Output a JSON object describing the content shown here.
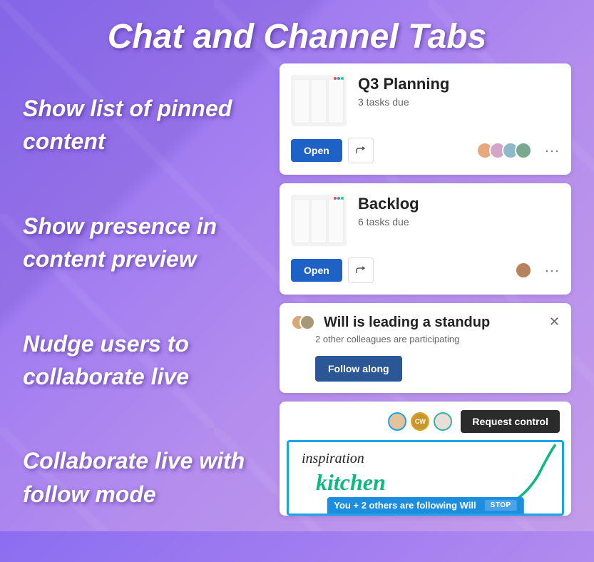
{
  "title": "Chat and Channel Tabs",
  "features": [
    "Show list of pinned content",
    "Show presence in content preview",
    "Nudge users to collaborate live",
    "Collaborate live with follow mode"
  ],
  "cards": [
    {
      "title": "Q3 Planning",
      "subtitle": "3 tasks due",
      "open_label": "Open",
      "avatars": [
        {
          "bg": "#e8a87c"
        },
        {
          "bg": "#d4a5c9"
        },
        {
          "bg": "#8fb8c9"
        },
        {
          "bg": "#7aa890"
        }
      ]
    },
    {
      "title": "Backlog",
      "subtitle": "6 tasks due",
      "open_label": "Open",
      "avatars": [
        {
          "bg": "#b8825f"
        }
      ]
    }
  ],
  "standup": {
    "title": "Will is leading a standup",
    "subtitle": "2 other colleagues are participating",
    "button": "Follow along"
  },
  "live": {
    "request_label": "Request control",
    "outlined_avatars": [
      {
        "border": "#1ba3e8",
        "bg": "#e6c29b",
        "text": ""
      },
      {
        "border": "#d4a82b",
        "bg": "#c9952e",
        "text": "CW"
      },
      {
        "border": "#3ab0a8",
        "bg": "#e8e0d8",
        "text": ""
      }
    ],
    "canvas": {
      "word1": "inspiration",
      "word2": "kitchen"
    },
    "follow_text": "You + 2 others are following Will",
    "stop_label": "STOP"
  }
}
